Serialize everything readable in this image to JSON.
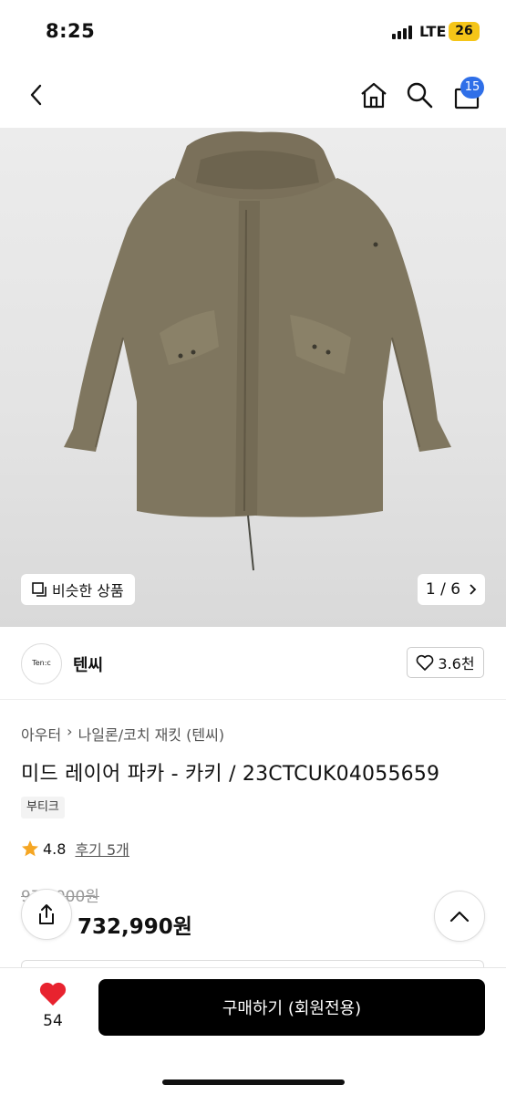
{
  "status": {
    "time": "8:25",
    "network": "LTE",
    "battery": "26"
  },
  "nav": {
    "cart_count": "15"
  },
  "gallery": {
    "similar_label": "비슷한 상품",
    "counter": "1 / 6"
  },
  "brand": {
    "logo_text": "Ten:c",
    "name": "텐씨",
    "likes": "3.6천"
  },
  "product": {
    "breadcrumb": [
      "아우터",
      "나일론/코치 재킷 (텐씨)"
    ],
    "title": "미드 레이어 파카 - 카키 / 23CTCUK04055659",
    "tag": "부티크",
    "rating": "4.8",
    "reviews": "후기 5개",
    "original_price": "977,000원",
    "sale_price": "732,990원"
  },
  "bottom": {
    "wish_count": "54",
    "buy_label": "구매하기 (회원전용)"
  },
  "colors": {
    "accent_blue": "#2f6fe8",
    "heart_red": "#e8232f",
    "star": "#f5a623",
    "jacket": "#7a705a"
  }
}
